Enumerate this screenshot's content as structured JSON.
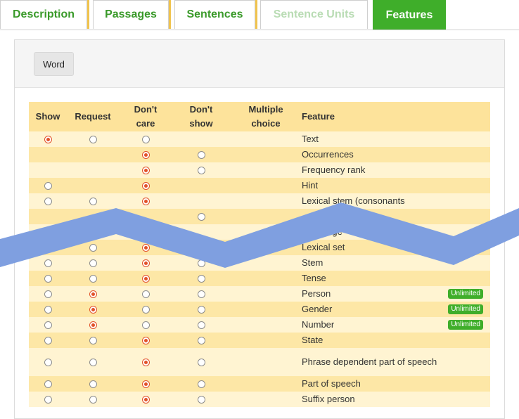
{
  "tabs": [
    {
      "label": "Description",
      "state": "normal"
    },
    {
      "label": "Passages",
      "state": "normal"
    },
    {
      "label": "Sentences",
      "state": "normal"
    },
    {
      "label": "Sentence Units",
      "state": "disabled"
    },
    {
      "label": "Features",
      "state": "active"
    }
  ],
  "toolbar": {
    "word_label": "Word"
  },
  "table": {
    "headers": {
      "show": "Show",
      "request": "Request",
      "dont_care_1": "Don't",
      "dont_care_2": "care",
      "dont_show_1": "Don't",
      "dont_show_2": "show",
      "multiple_1": "Multiple",
      "multiple_2": "choice",
      "feature": "Feature"
    },
    "rows": [
      {
        "feature": "Text",
        "show": "on",
        "request": "off",
        "dontcare": "off",
        "dontshow": "none",
        "badge": ""
      },
      {
        "feature": "Occurrences",
        "show": "none",
        "request": "none",
        "dontcare": "on",
        "dontshow": "off",
        "badge": ""
      },
      {
        "feature": "Frequency rank",
        "show": "none",
        "request": "none",
        "dontcare": "on",
        "dontshow": "off",
        "badge": ""
      },
      {
        "feature": "Hint",
        "show": "off",
        "request": "none",
        "dontcare": "on",
        "dontshow": "none",
        "badge": ""
      },
      {
        "feature": "Lexical stem (consonants",
        "show": "off",
        "request": "off",
        "dontcare": "on",
        "dontshow": "none",
        "badge": ""
      },
      {
        "feature": "",
        "show": "none",
        "request": "none",
        "dontcare": "none",
        "dontshow": "off",
        "badge": ""
      },
      {
        "feature": "Language",
        "show": "none",
        "request": "off",
        "dontcare": "on",
        "dontshow": "none",
        "badge": ""
      },
      {
        "feature": "Lexical set",
        "show": "off",
        "request": "off",
        "dontcare": "on",
        "dontshow": "off",
        "badge": ""
      },
      {
        "feature": "Stem",
        "show": "off",
        "request": "off",
        "dontcare": "on",
        "dontshow": "off",
        "badge": ""
      },
      {
        "feature": "Tense",
        "show": "off",
        "request": "off",
        "dontcare": "on",
        "dontshow": "off",
        "badge": ""
      },
      {
        "feature": "Person",
        "show": "off",
        "request": "on",
        "dontcare": "off",
        "dontshow": "off",
        "badge": "Unlimited"
      },
      {
        "feature": "Gender",
        "show": "off",
        "request": "on",
        "dontcare": "off",
        "dontshow": "off",
        "badge": "Unlimited"
      },
      {
        "feature": "Number",
        "show": "off",
        "request": "on",
        "dontcare": "off",
        "dontshow": "off",
        "badge": "Unlimited"
      },
      {
        "feature": "State",
        "show": "off",
        "request": "off",
        "dontcare": "on",
        "dontshow": "off",
        "badge": ""
      },
      {
        "feature": "Phrase dependent part of speech",
        "show": "off",
        "request": "off",
        "dontcare": "on",
        "dontshow": "off",
        "badge": ""
      },
      {
        "feature": "Part of speech",
        "show": "off",
        "request": "off",
        "dontcare": "on",
        "dontshow": "off",
        "badge": ""
      },
      {
        "feature": "Suffix person",
        "show": "off",
        "request": "off",
        "dontcare": "on",
        "dontshow": "off",
        "badge": ""
      }
    ]
  },
  "colors": {
    "accent_green": "#3fae2a",
    "header_yellow": "#fde39b",
    "radio_selected": "#e2512a",
    "overlay_blue": "#7f9fe0"
  }
}
